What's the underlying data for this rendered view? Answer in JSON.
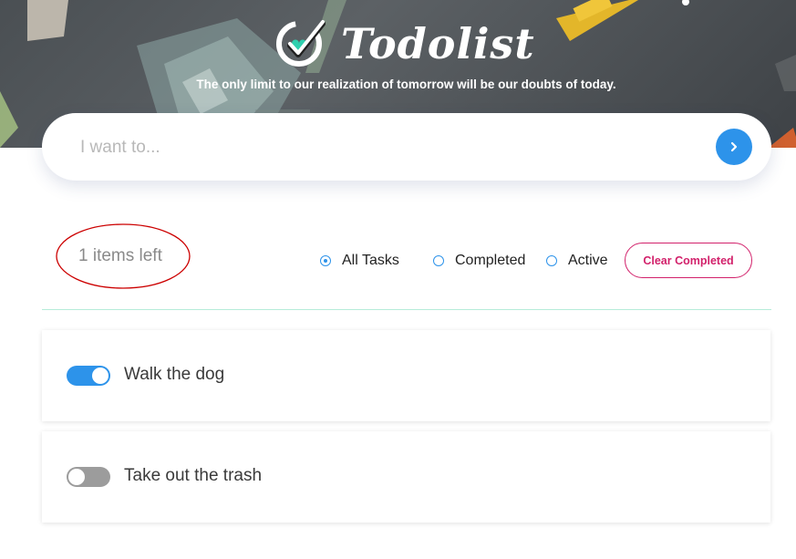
{
  "header": {
    "app_name": "Todolist",
    "tagline": "The only limit to our realization of tomorrow will be our doubts of today."
  },
  "new_todo": {
    "placeholder": "I want to...",
    "value": "",
    "submit_icon": "chevron-right-icon"
  },
  "toolbar": {
    "items_left": "1 items left",
    "filters": [
      {
        "label": "All Tasks",
        "selected": true
      },
      {
        "label": "Completed",
        "selected": false
      },
      {
        "label": "Active",
        "selected": false
      }
    ],
    "clear_completed_label": "Clear Completed"
  },
  "tasks": [
    {
      "text": "Walk the dog",
      "completed": true
    },
    {
      "text": "Take out the trash",
      "completed": false
    }
  ],
  "colors": {
    "accent_blue": "#2d93ea",
    "clear_button_pink": "#d2216b",
    "logo_check_teal": "#2ecfae",
    "annotation_red": "#cc0000",
    "divider_mint": "#b6ecd9"
  }
}
